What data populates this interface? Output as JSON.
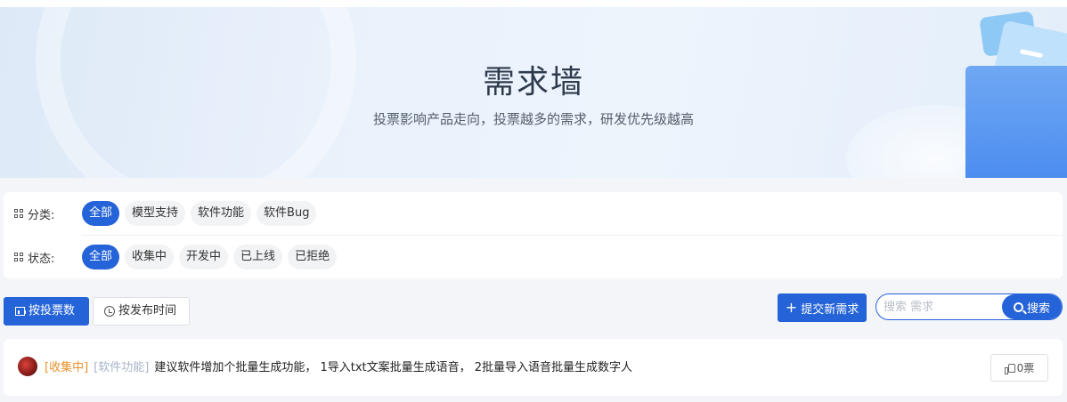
{
  "hero": {
    "title": "需求墙",
    "subtitle": "投票影响产品走向，投票越多的需求，研发优先级越高"
  },
  "filters": {
    "category": {
      "label": "分类:",
      "options": [
        "全部",
        "模型支持",
        "软件功能",
        "软件Bug"
      ],
      "selected": "全部"
    },
    "status": {
      "label": "状态:",
      "options": [
        "全部",
        "收集中",
        "开发中",
        "已上线",
        "已拒绝"
      ],
      "selected": "全部"
    }
  },
  "toolbar": {
    "sort_votes_label": "按投票数",
    "sort_time_label": "按发布时间",
    "active_sort": "votes",
    "submit_label": "提交新需求",
    "search_placeholder": "搜索 需求",
    "search_value": "",
    "search_button_label": "搜索"
  },
  "posts": [
    {
      "status_tag": "[收集中]",
      "category_tag": "[软件功能]",
      "title": "建议软件增加个批量生成功能， 1导入txt文案批量生成语音， 2批量导入语音批量生成数字人",
      "votes_label": "0票"
    }
  ],
  "colors": {
    "primary": "#2563d8",
    "status_collecting": "#e8902a",
    "category_tag": "#a8b4c8"
  },
  "icons": {
    "filter": "grid-icon",
    "sort_votes": "bar-chart-icon",
    "sort_time": "clock-icon",
    "submit": "plus-icon",
    "search": "search-icon",
    "vote": "thumb-up-icon"
  }
}
